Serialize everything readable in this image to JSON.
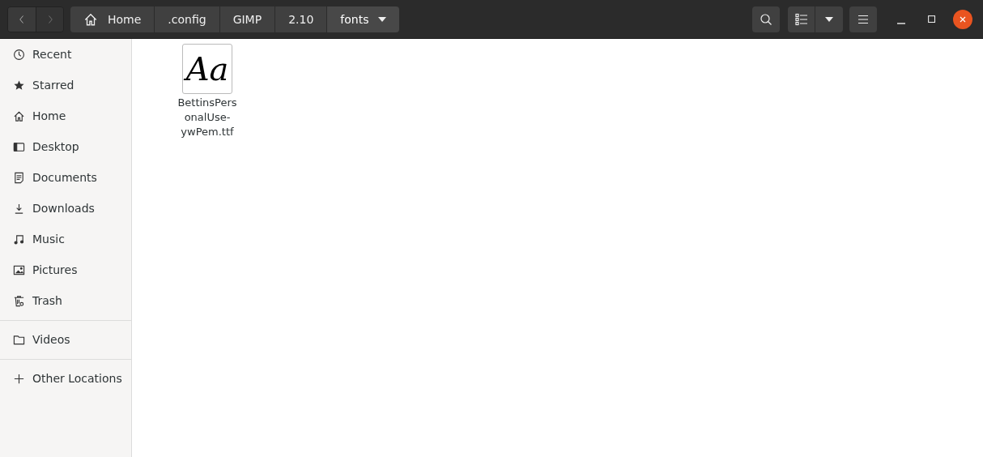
{
  "header": {
    "nav": [
      {
        "kind": "back",
        "disabled": false
      },
      {
        "kind": "forward",
        "disabled": true
      }
    ],
    "breadcrumbs": [
      {
        "label": "Home",
        "kind": "home",
        "selected": false
      },
      {
        "label": ".config",
        "kind": "folder",
        "selected": false
      },
      {
        "label": "GIMP",
        "kind": "folder",
        "selected": false
      },
      {
        "label": "2.10",
        "kind": "folder",
        "selected": false
      },
      {
        "label": "fonts",
        "kind": "folder",
        "selected": true
      }
    ]
  },
  "sidebar": {
    "sections": [
      {
        "items": [
          {
            "label": "Recent",
            "kind": "recent"
          },
          {
            "label": "Starred",
            "kind": "star"
          },
          {
            "label": "Home",
            "kind": "home"
          },
          {
            "label": "Desktop",
            "kind": "desktop"
          },
          {
            "label": "Documents",
            "kind": "documents"
          },
          {
            "label": "Downloads",
            "kind": "downloads"
          },
          {
            "label": "Music",
            "kind": "music"
          },
          {
            "label": "Pictures",
            "kind": "pictures"
          },
          {
            "label": "Trash",
            "kind": "trash"
          }
        ]
      },
      {
        "items": [
          {
            "label": "Videos",
            "kind": "folder"
          }
        ]
      },
      {
        "items": [
          {
            "label": "Other Locations",
            "kind": "plus"
          }
        ]
      }
    ]
  },
  "files": [
    {
      "name": "BettinsPersonalUse-ywPem.ttf",
      "kind": "font",
      "preview_text": "Aa"
    }
  ]
}
